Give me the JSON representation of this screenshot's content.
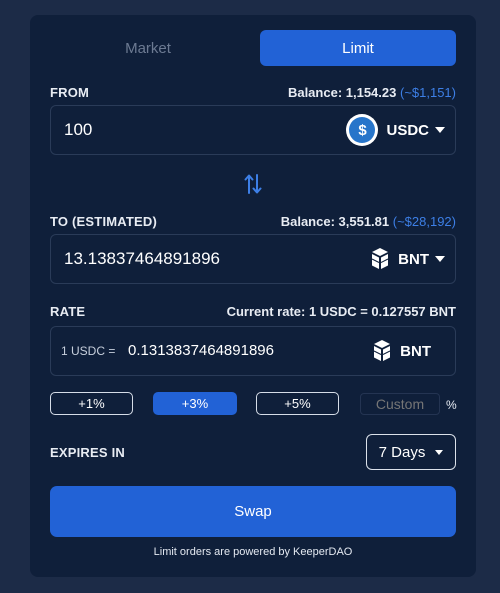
{
  "tabs": [
    {
      "label": "Market",
      "active": false
    },
    {
      "label": "Limit",
      "active": true
    }
  ],
  "from": {
    "label": "FROM",
    "balance_label": "Balance: 1,154.23",
    "balance_usd": "(~$1,151)",
    "amount": "100",
    "token": "USDC",
    "token_icon": "usdc-icon"
  },
  "to": {
    "label": "TO (ESTIMATED)",
    "balance_label": "Balance: 3,551.81",
    "balance_usd": "(~$28,192)",
    "amount": "13.13837464891896",
    "token": "BNT",
    "token_icon": "bnt-icon"
  },
  "rate": {
    "label": "RATE",
    "current_rate": "Current rate: 1 USDC = 0.127557 BNT",
    "prefix": "1 USDC =",
    "value": "0.1313837464891896",
    "token": "BNT"
  },
  "percent_options": [
    {
      "label": "+1%",
      "selected": false
    },
    {
      "label": "+3%",
      "selected": true
    },
    {
      "label": "+5%",
      "selected": false
    }
  ],
  "custom": {
    "placeholder": "Custom",
    "suffix": "%"
  },
  "expires": {
    "label": "EXPIRES IN",
    "selected": "7 Days"
  },
  "swap_button": "Swap",
  "footer": "Limit orders are powered by KeeperDAO",
  "colors": {
    "page_bg": "#1c2b47",
    "card_bg": "#0f1f3a",
    "accent": "#2262d6",
    "usd_link": "#3d7fe6"
  }
}
